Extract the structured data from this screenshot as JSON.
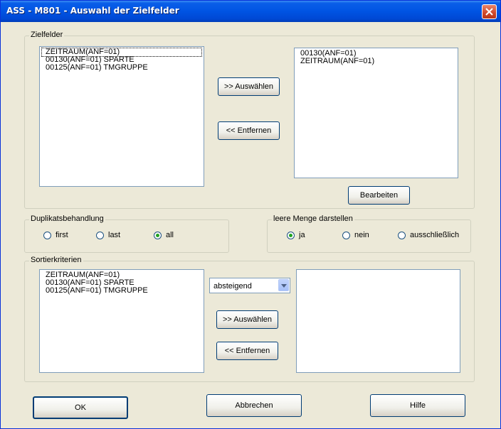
{
  "window": {
    "title": "ASS - M801 - Auswahl der Zielfelder"
  },
  "zielfelder": {
    "legend": "Zielfelder",
    "available_items": [
      "ZEITRAUM(ANF=01)",
      "00130(ANF=01) SPARTE",
      "00125(ANF=01) TMGRUPPE"
    ],
    "selected_items": [
      "00130(ANF=01)",
      "ZEITRAUM(ANF=01)"
    ],
    "select_label": ">> Auswählen",
    "remove_label": "<< Entfernen",
    "edit_label": "Bearbeiten"
  },
  "duplikate": {
    "legend": "Duplikatsbehandlung",
    "options": [
      "first",
      "last",
      "all"
    ],
    "selected": "all"
  },
  "leere_menge": {
    "legend": "leere Menge darstellen",
    "options": [
      "ja",
      "nein",
      "ausschließlich"
    ],
    "selected": "ja"
  },
  "sortierkriterien": {
    "legend": "Sortierkriterien",
    "available_items": [
      "ZEITRAUM(ANF=01)",
      "00130(ANF=01) SPARTE",
      "00125(ANF=01) TMGRUPPE"
    ],
    "selected_items": [],
    "order_value": "absteigend",
    "select_label": ">> Auswählen",
    "remove_label": "<< Entfernen"
  },
  "footer": {
    "ok_label": "OK",
    "cancel_label": "Abbrechen",
    "help_label": "Hilfe"
  }
}
